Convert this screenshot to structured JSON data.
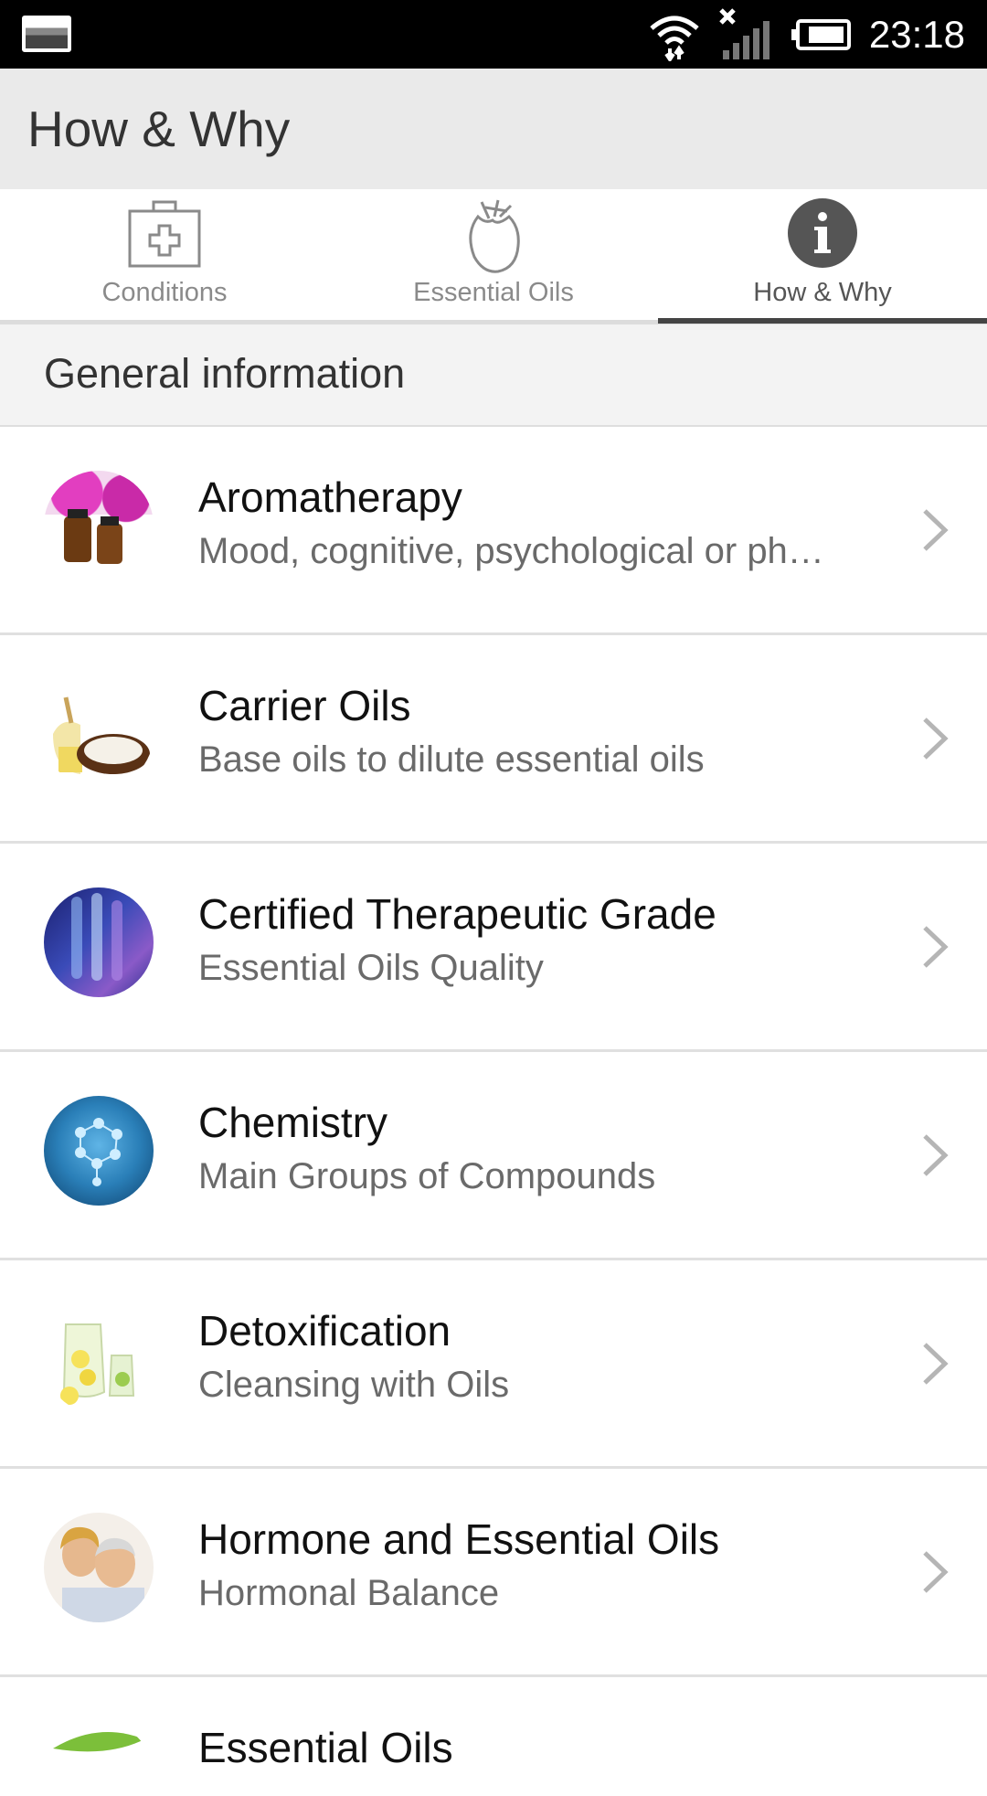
{
  "status_bar": {
    "time": "23:18"
  },
  "app_bar": {
    "title": "How & Why"
  },
  "tabs": [
    {
      "label": "Conditions",
      "icon": "first-aid-kit-icon",
      "active": false
    },
    {
      "label": "Essential Oils",
      "icon": "flower-icon",
      "active": false
    },
    {
      "label": "How & Why",
      "icon": "info-icon",
      "active": true
    }
  ],
  "section": {
    "title": "General information"
  },
  "items": [
    {
      "title": "Aromatherapy",
      "subtitle": "Mood, cognitive, psychological or ph…",
      "thumb": "aromatherapy-thumb"
    },
    {
      "title": "Carrier Oils",
      "subtitle": "Base oils to dilute essential oils",
      "thumb": "coconut-thumb"
    },
    {
      "title": "Certified Therapeutic Grade",
      "subtitle": "Essential Oils Quality",
      "thumb": "test-tubes-thumb"
    },
    {
      "title": "Chemistry",
      "subtitle": "Main Groups of Compounds",
      "thumb": "molecule-thumb"
    },
    {
      "title": "Detoxification",
      "subtitle": "Cleansing with Oils",
      "thumb": "lemon-water-thumb"
    },
    {
      "title": "Hormone and Essential Oils",
      "subtitle": "Hormonal Balance",
      "thumb": "couple-thumb"
    },
    {
      "title": "Essential Oils",
      "subtitle": "",
      "thumb": "leaf-thumb"
    }
  ],
  "colors": {
    "accent": "#444444",
    "appbar": "#eaeaea",
    "statusbar": "#000000"
  }
}
